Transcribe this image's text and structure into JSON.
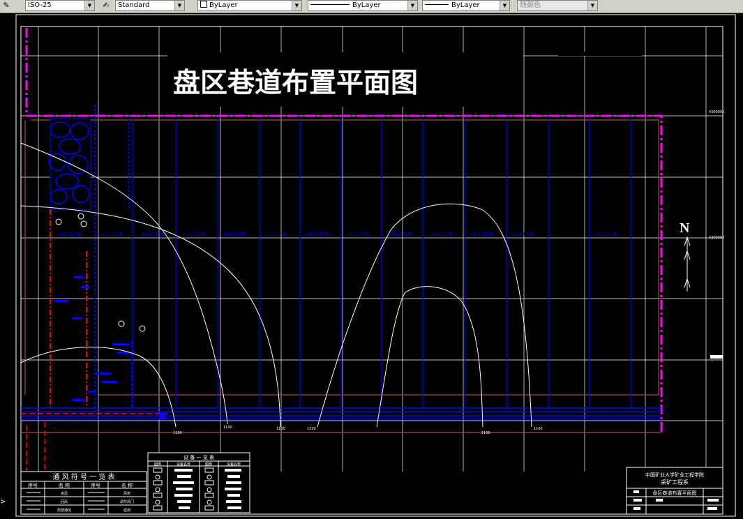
{
  "toolbar": {
    "dimstyle_value": "ISO-25",
    "textstyle_value": "Standard",
    "color_value": "ByLayer",
    "linetype_value": "ByLayer",
    "lineweight_value": "ByLayer",
    "plotstyle_value": "随颜色"
  },
  "drawing": {
    "title": "盘区巷道布置平面图",
    "north_label": "N",
    "coords": {
      "top": "4300000",
      "mid": "4300000"
    },
    "stope_labels": [
      "4301工作面",
      "4302工作面",
      "4303工作面",
      "4304工作面",
      "4305工作面",
      "4306工作面",
      "4307工作面",
      "4308工作面",
      "4309工作面",
      "4310工作面",
      "4311工作面",
      "4312工作面",
      "4313工作面"
    ],
    "contour_labels": [
      "1100",
      "1100",
      "1100",
      "1100",
      "1100",
      "1100"
    ]
  },
  "ventilation_table": {
    "title": "通 风 符 号 一 览 表",
    "headers": [
      "序号",
      "名 称",
      "序号",
      "名 称"
    ],
    "rows": [
      [
        "",
        "进风",
        "",
        "风桥"
      ],
      [
        "",
        "回风",
        "",
        "调节风门"
      ],
      [
        "",
        "局部通风",
        "",
        "密闭"
      ]
    ]
  },
  "equipment_table": {
    "title": "设 备 一 览 表",
    "headers": [
      "图例",
      "设备名称",
      "图例",
      "设备名称"
    ]
  },
  "title_block": {
    "school": "中国矿业大学矿业工程学院",
    "department": "采矿工程系",
    "drawing_name": "盘区巷道布置平面图"
  },
  "colors": {
    "background": "#000000",
    "magenta": "#ff00ff",
    "blue": "#0000ff",
    "red": "#ff0000",
    "brown": "#a0522d",
    "white": "#ffffff"
  }
}
